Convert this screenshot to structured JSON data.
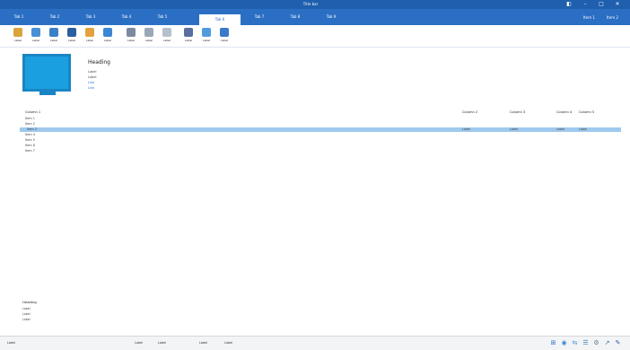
{
  "titlebar": {
    "title": "Title bar",
    "controls": [
      {
        "label": "◧",
        "icon": "pin-icon"
      },
      {
        "label": "–",
        "icon": "minimize-icon"
      },
      {
        "label": "□",
        "icon": "maximize-icon"
      },
      {
        "label": "✕",
        "icon": "close-icon"
      }
    ]
  },
  "menubar": {
    "tabs": [
      "Tab 1",
      "Tab 2",
      "Tab 3",
      "Tab 4",
      "Tab 5",
      "Tab 6",
      "Tab 7",
      "Tab 8",
      "Tab 9"
    ],
    "active_index": 5,
    "account": [
      "Item 1",
      "Item 2"
    ]
  },
  "toolbar": {
    "items": [
      {
        "label": "Label",
        "icon": "back-icon",
        "color": "#d9a43a"
      },
      {
        "label": "Label",
        "icon": "search-icon",
        "color": "#4a8fd6"
      },
      {
        "label": "Label",
        "icon": "scan-icon",
        "color": "#3b7fc9"
      },
      {
        "label": "Label",
        "icon": "device-icon",
        "color": "#2c5f9e"
      },
      {
        "label": "Label",
        "icon": "report-icon",
        "color": "#e3a23b"
      },
      {
        "label": "Label",
        "icon": "monitor-icon",
        "color": "#3c86d4"
      },
      {
        "label": "Label",
        "icon": "settings-icon",
        "color": "#7a8aa0"
      },
      {
        "label": "Label",
        "icon": "copy-icon",
        "color": "#9aa7b8"
      },
      {
        "label": "Label",
        "icon": "tools-icon",
        "color": "#b6c0cc"
      },
      {
        "label": "Label",
        "icon": "monitor-search-icon",
        "color": "#5a6fa0"
      },
      {
        "label": "Label",
        "icon": "edit-icon",
        "color": "#4f9be0"
      },
      {
        "label": "Label",
        "icon": "find-icon",
        "color": "#3a7ac8"
      }
    ]
  },
  "header": {
    "title": "Heading",
    "lines": [
      "Label",
      "Label"
    ],
    "links": [
      "Link",
      "Link"
    ]
  },
  "table": {
    "columns": [
      "Column 1",
      "Column 2",
      "Column 3",
      "Column 4",
      "Column 5"
    ],
    "rows": [
      {
        "label": "Item 1",
        "selected": false,
        "cells": [
          "",
          "",
          "",
          ""
        ]
      },
      {
        "label": "Item 2",
        "selected": false,
        "cells": [
          "",
          "",
          "",
          ""
        ]
      },
      {
        "label": "Item 3",
        "selected": true,
        "cells": [
          "Label",
          "Label",
          "Label",
          "Label"
        ]
      },
      {
        "label": "Item 4",
        "selected": false,
        "cells": [
          "",
          "",
          "",
          ""
        ]
      },
      {
        "label": "Item 5",
        "selected": false,
        "cells": [
          "",
          "",
          "",
          ""
        ]
      },
      {
        "label": "Item 6",
        "selected": false,
        "cells": [
          "",
          "",
          "",
          ""
        ]
      },
      {
        "label": "Item 7",
        "selected": false,
        "cells": [
          "",
          "",
          "",
          ""
        ]
      }
    ]
  },
  "log": {
    "title": "Heading",
    "entries": [
      "Label",
      "Label",
      "Label"
    ]
  },
  "statusbar": {
    "items": [
      "Label",
      "Label",
      "Label",
      "Label",
      "Label"
    ],
    "tray": [
      "⊞",
      "◉",
      "⇆",
      "☰",
      "⚙",
      "↗",
      "✎"
    ]
  },
  "colors": {
    "titlebar": "#1f5fae",
    "menubar": "#2b6fc5",
    "selection": "#9fc9ee",
    "monitor": "#1aa0e0",
    "link": "#2a6ec8"
  }
}
